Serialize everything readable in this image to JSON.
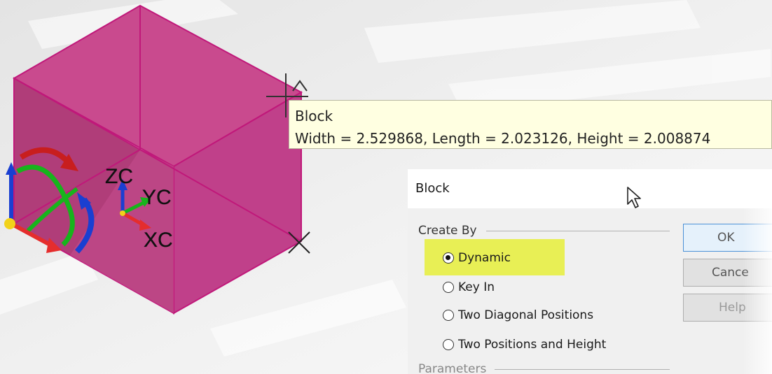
{
  "viewport": {
    "axis_labels": {
      "zc": "ZC",
      "yc": "YC",
      "xc": "XC"
    },
    "colors": {
      "block_face": "#cc4490",
      "block_edge": "#c0187a"
    }
  },
  "tooltip": {
    "title": "Block",
    "dimensions": "Width = 2.529868, Length = 2.023126, Height = 2.008874"
  },
  "dialog": {
    "title": "Block",
    "create_by_label": "Create By",
    "options": [
      {
        "label": "Dynamic",
        "checked": true
      },
      {
        "label": "Key In",
        "checked": false
      },
      {
        "label": "Two Diagonal Positions",
        "checked": false
      },
      {
        "label": "Two Positions and Height",
        "checked": false
      }
    ],
    "parameters_label": "Parameters",
    "buttons": {
      "ok": "OK",
      "cancel": "Cance",
      "help": "Help"
    },
    "highlight_color": "#e6ee3a"
  }
}
